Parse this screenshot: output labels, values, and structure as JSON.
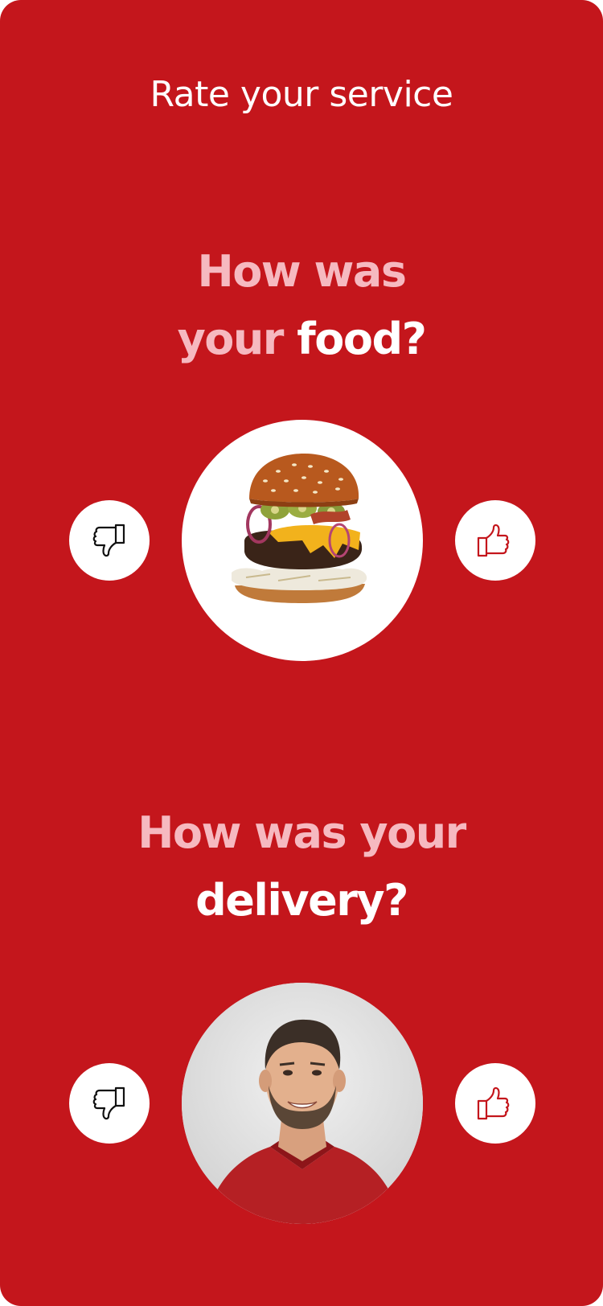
{
  "header": {
    "title": "Rate your service"
  },
  "food_question": {
    "part1": "How was",
    "part2": "your",
    "part3": "food?"
  },
  "delivery_question": {
    "part1": "How was your",
    "part2": "delivery?"
  },
  "images": {
    "food": "burger",
    "delivery": "delivery-person"
  },
  "icons": {
    "dislike": "thumbs-down-icon",
    "like": "thumbs-up-icon"
  },
  "colors": {
    "background": "#c4161c",
    "accent_text": "#f6b9c0",
    "white": "#ffffff",
    "like_icon": "#c4161c",
    "dislike_icon": "#111111"
  }
}
